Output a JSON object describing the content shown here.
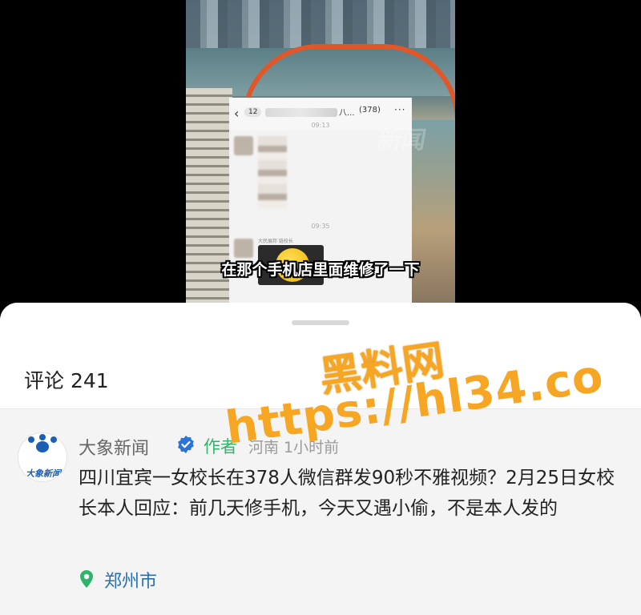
{
  "video": {
    "chat": {
      "badge": "12",
      "title_suffix": "八...",
      "member_count": "(378)",
      "more": "···",
      "time1": "09:13",
      "time2": "09:35",
      "sender": "大民展邦 链校长"
    },
    "faint_watermark": "新闻",
    "subtitle": "在那个手机店里面维修了一下"
  },
  "comments": {
    "title": "评论 241",
    "items": [
      {
        "avatar_text": "大象新闻",
        "author": "大象新闻",
        "author_tag": "作者",
        "meta": "河南 1小时前",
        "text": "四川宜宾一女校长在378人微信群发90秒不雅视频？2月25日女校长本人回应：前几天修手机，今天又遇小偷，不是本人发的",
        "location": "郑州市"
      }
    ]
  },
  "overlay": {
    "watermark_line1": "黑料网",
    "watermark_line2": "https://hl34.co",
    "color": "#f6a623"
  },
  "colors": {
    "author_tag": "#2fb56b",
    "location": "#2a6fb0",
    "verified": "#2a73d8"
  }
}
